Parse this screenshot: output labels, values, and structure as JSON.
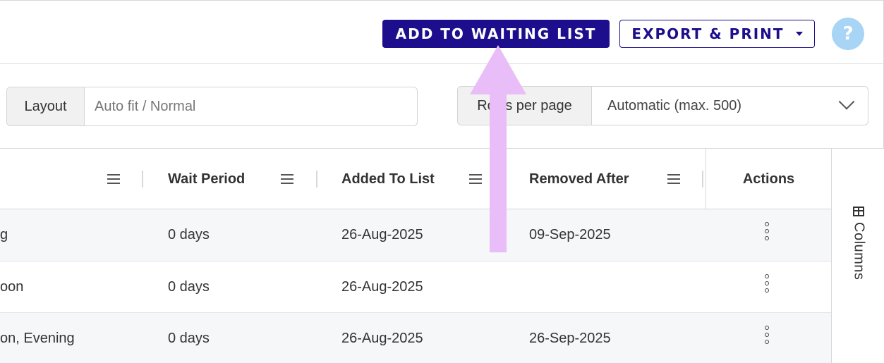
{
  "toolbar": {
    "add_to_waiting_list_label": "ADD TO WAITING LIST",
    "export_print_label": "EXPORT & PRINT",
    "help_label": "?"
  },
  "filters": {
    "layout_label": "Layout",
    "layout_value": "Auto fit / Normal",
    "rows_per_page_label": "Rows per page",
    "rows_per_page_value": "Automatic (max. 500)"
  },
  "table": {
    "columns": [
      "Wait Period",
      "Added To List",
      "Removed After",
      "Actions"
    ],
    "rows": [
      {
        "first": "g",
        "wait_period": "0 days",
        "added": "26-Aug-2025",
        "removed": "09-Sep-2025"
      },
      {
        "first": "oon",
        "wait_period": "0 days",
        "added": "26-Aug-2025",
        "removed": ""
      },
      {
        "first": "on, Evening",
        "wait_period": "0 days",
        "added": "26-Aug-2025",
        "removed": "26-Sep-2025"
      }
    ]
  },
  "side_panel": {
    "columns_label": "Columns"
  },
  "colors": {
    "primary": "#1c0e8c",
    "help_bg": "#a8d4f5",
    "annotation_arrow": "#e9bdf7"
  },
  "icons": [
    "question-mark-icon",
    "caret-down-icon",
    "chevron-down-icon",
    "column-menu-icon",
    "kebab-menu-icon",
    "columns-icon",
    "annotation-arrow"
  ]
}
